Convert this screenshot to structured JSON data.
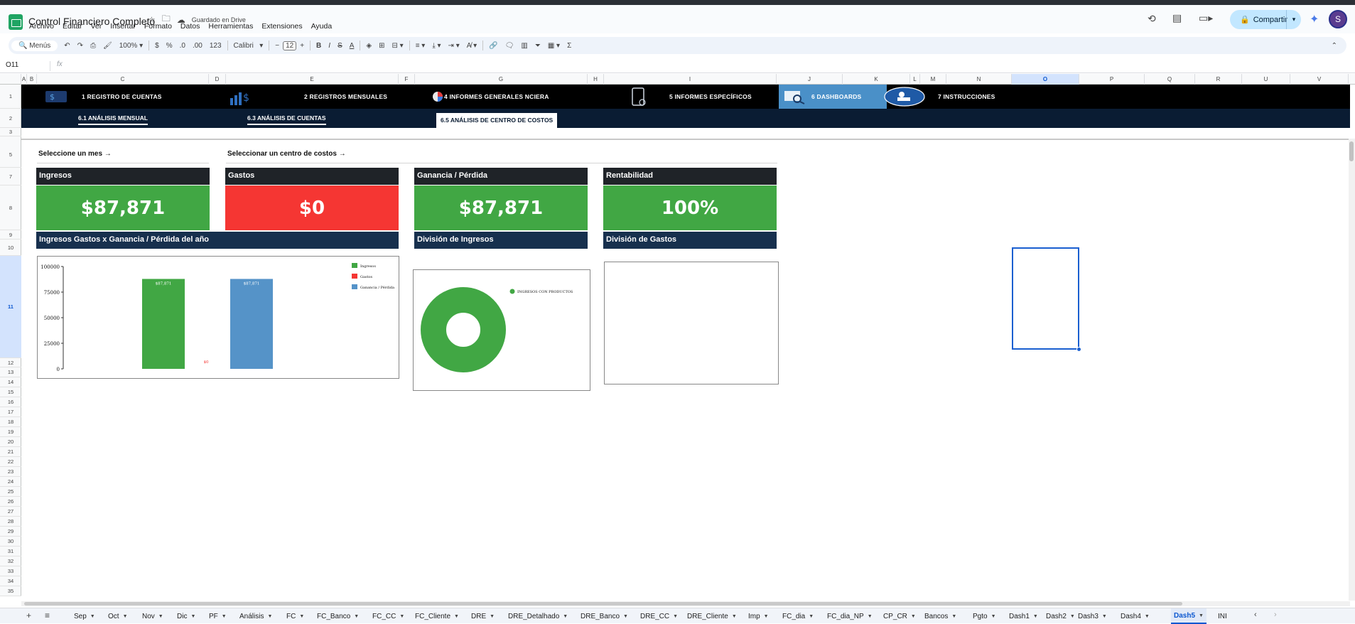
{
  "app": {
    "title": "Control Financiero Completo",
    "saved": "Guardado en Drive",
    "menus": [
      "Archivo",
      "Editar",
      "Ver",
      "Insertar",
      "Formato",
      "Datos",
      "Herramientas",
      "Extensiones",
      "Ayuda"
    ],
    "share_label": "Compartir",
    "avatar_letter": "S"
  },
  "toolbar": {
    "search_label": "Menús",
    "zoom": "100%",
    "currency": "$",
    "percent": "%",
    "dec_less": ".0",
    "dec_more": ".00",
    "number_format": "123",
    "font": "Calibri",
    "font_size": "12",
    "sigma": "Σ"
  },
  "formula_bar": {
    "cell_ref": "O11",
    "fx": "fx"
  },
  "columns": [
    "A",
    "B",
    "C",
    "D",
    "E",
    "F",
    "G",
    "H",
    "I",
    "J",
    "K",
    "L",
    "M",
    "N",
    "O",
    "P",
    "Q",
    "R",
    "U",
    "V"
  ],
  "rows": [
    "1",
    "2",
    "3",
    "5",
    "7",
    "8",
    "9",
    "10",
    "11",
    "12",
    "13",
    "14",
    "15",
    "16",
    "17",
    "18",
    "19",
    "20",
    "21",
    "22",
    "23",
    "24",
    "25",
    "26",
    "27",
    "28",
    "29",
    "30",
    "31",
    "32",
    "33",
    "34",
    "35",
    "36"
  ],
  "nav": {
    "items": [
      "1 REGISTRO DE CUENTAS",
      "2 REGISTROS MENSUALES",
      "4 INFORMES GENERALES   NCIERA",
      "5 INFORMES ESPECÍFICOS",
      "6 DASHBOARDS",
      "7 INSTRUCCIONES"
    ],
    "sub_items": [
      "6.1 ANÁLISIS MENSUAL",
      "6.3 ANÁLISIS DE CUENTAS",
      "6.5 ANÁLISIS DE CENTRO DE COSTOS"
    ]
  },
  "selectors": {
    "month": "Seleccione un mes →",
    "cost_center": "Seleccionar un centro de costos →"
  },
  "kpis": [
    {
      "label": "Ingresos",
      "value": "$87,871"
    },
    {
      "label": "Gastos",
      "value": "$0"
    },
    {
      "label": "Ganancia / Pérdida",
      "value": "$87,871"
    },
    {
      "label": "Rentabilidad",
      "value": "100%"
    }
  ],
  "sections": {
    "year_chart": "Ingresos Gastos x Ganancia / Pérdida del año",
    "income_split": "División de Ingresos",
    "expense_split": "División de Gastos"
  },
  "colors": {
    "green": "#41a744",
    "red": "#f53633",
    "blue": "#5593c8",
    "dark": "#1f2328",
    "navy": "#17304e"
  },
  "chart_data": [
    {
      "type": "bar",
      "categories": [
        "Ingresos",
        "Gastos",
        "Ganancia / Pérdida"
      ],
      "values": [
        87871,
        0,
        87871
      ],
      "data_labels": [
        "$87,871",
        "$0",
        "$87,871"
      ],
      "colors": [
        "#41a744",
        "#f53633",
        "#5593c8"
      ],
      "yticks": [
        "100000",
        "75000",
        "50000",
        "25000",
        "0"
      ],
      "ylim": [
        0,
        100000
      ],
      "legend": [
        "Ingresos",
        "Gastos",
        "Ganancia / Pérdida"
      ],
      "legend_position": "top-right",
      "grid": false
    },
    {
      "type": "pie",
      "categories": [
        "INGRESOS CON PRODUCTOS"
      ],
      "values": [
        87871
      ],
      "colors": [
        "#41a744"
      ],
      "legend_position": "top-right"
    }
  ],
  "sheet_tabs": [
    "Sep",
    "Oct",
    "Nov",
    "Dic",
    "PF",
    "Análisis",
    "FC",
    "FC_Banco",
    "FC_CC",
    "FC_Cliente",
    "DRE",
    "DRE_Detalhado",
    "DRE_Banco",
    "DRE_CC",
    "DRE_Cliente",
    "Imp",
    "FC_dia",
    "FC_dia_NP",
    "CP_CR",
    "Bancos",
    "Pgto",
    "Dash1",
    "Dash2",
    "Dash3",
    "Dash4",
    "Dash5",
    "INI"
  ],
  "active_tab": "Dash5"
}
